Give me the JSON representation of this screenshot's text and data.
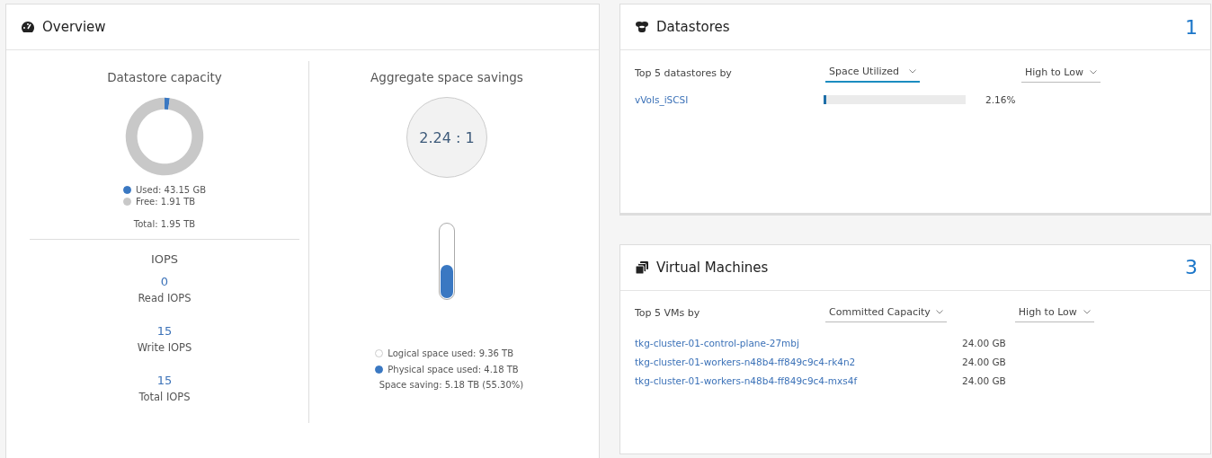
{
  "overview": {
    "title": "Overview",
    "capacity": {
      "title": "Datastore capacity",
      "chart_data": {
        "type": "donut",
        "values": [
          2.16,
          97.84
        ]
      },
      "legend": [
        {
          "label": "Used: 43.15 GB",
          "color": "#3a78c2"
        },
        {
          "label": "Free: 1.91 TB",
          "color": "#c8c8c8"
        }
      ],
      "total": "Total: 1.95 TB"
    },
    "iops": {
      "title": "IOPS",
      "metrics": [
        {
          "value": "0",
          "label": "Read IOPS"
        },
        {
          "value": "15",
          "label": "Write IOPS"
        },
        {
          "value": "15",
          "label": "Total IOPS"
        }
      ]
    },
    "savings": {
      "title": "Aggregate space savings",
      "ratio": "2.24 : 1",
      "level": 0.45,
      "legend": [
        {
          "label": "Logical space used: 9.36 TB",
          "color": "#ffffff"
        },
        {
          "label": "Physical space used: 4.18 TB",
          "color": "#3a78c2"
        }
      ],
      "note": "Space saving: 5.18 TB (55.30%)"
    }
  },
  "datastores": {
    "title": "Datastores",
    "count": "1",
    "by_label": "Top 5 datastores by",
    "dropdowns": [
      {
        "value": "Space Utilized",
        "active": true
      },
      {
        "value": "High to Low",
        "active": false
      }
    ],
    "rows": [
      {
        "name": "vVols_iSCSI",
        "level": 0.0216,
        "reading": "2.16%"
      }
    ]
  },
  "vms": {
    "title": "Virtual Machines",
    "count": "3",
    "by_label": "Top 5 VMs by",
    "dropdowns": [
      {
        "value": "Committed Capacity",
        "active": false
      },
      {
        "value": "High to Low",
        "active": false
      }
    ],
    "rows": [
      {
        "name": "tkg-cluster-01-control-plane-27mbj",
        "value": "24.00 GB"
      },
      {
        "name": "tkg-cluster-01-workers-n48b4-ff849c9c4-rk4n2",
        "value": "24.00 GB"
      },
      {
        "name": "tkg-cluster-01-workers-n48b4-ff849c9c4-mxs4f",
        "value": "24.00 GB"
      }
    ]
  }
}
